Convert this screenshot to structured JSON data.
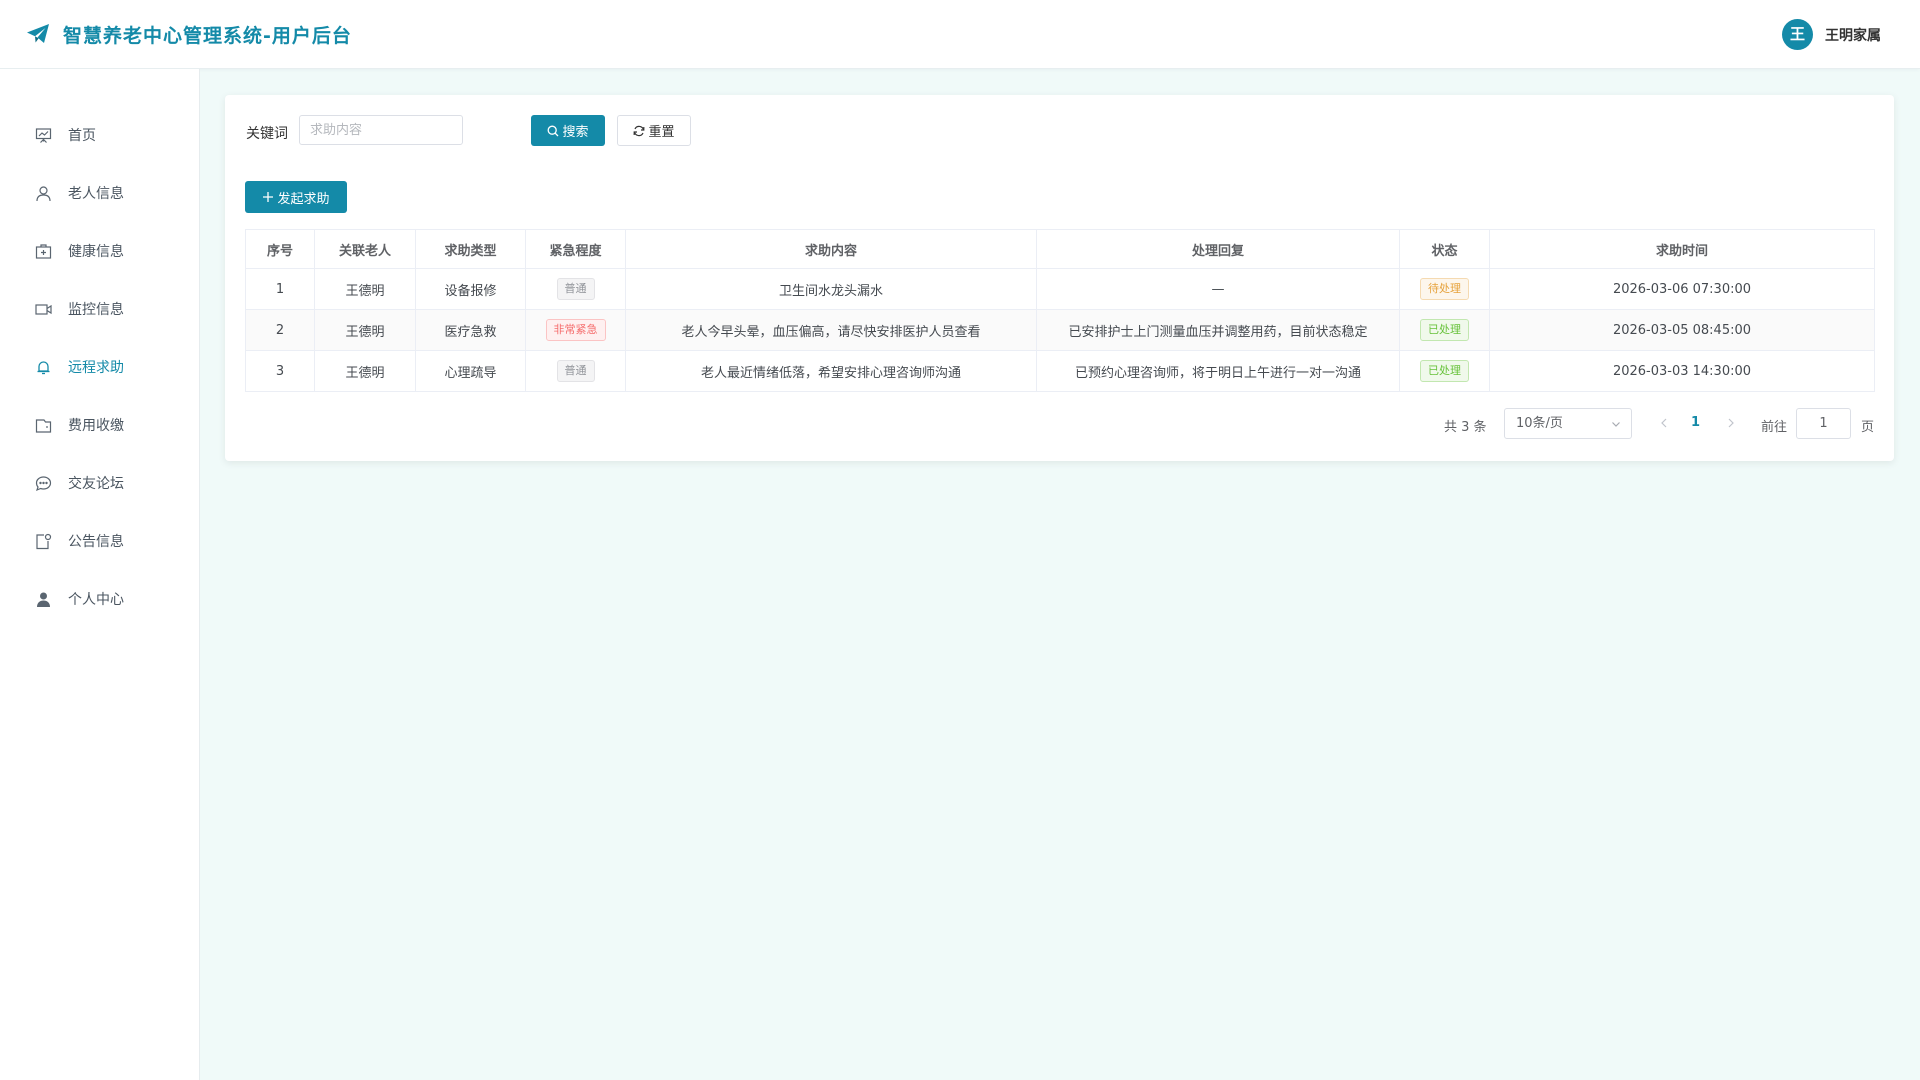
{
  "app": {
    "title": "智慧养老中心管理系统-用户后台",
    "brand_color": "#148aa8"
  },
  "user": {
    "avatar_letter": "王",
    "name": "王明家属"
  },
  "sidebar": {
    "items": [
      {
        "label": "首页",
        "icon": "presentation-icon",
        "active": false
      },
      {
        "label": "老人信息",
        "icon": "user-icon",
        "active": false
      },
      {
        "label": "健康信息",
        "icon": "medical-box-icon",
        "active": false
      },
      {
        "label": "监控信息",
        "icon": "video-camera-icon",
        "active": false
      },
      {
        "label": "远程求助",
        "icon": "bell-icon",
        "active": true
      },
      {
        "label": "费用收缴",
        "icon": "wallet-icon",
        "active": false
      },
      {
        "label": "交友论坛",
        "icon": "chat-icon",
        "active": false
      },
      {
        "label": "公告信息",
        "icon": "notice-icon",
        "active": false
      },
      {
        "label": "个人中心",
        "icon": "person-filled-icon",
        "active": false
      }
    ]
  },
  "search": {
    "label": "关键词",
    "placeholder": "求助内容",
    "search_button": "搜索",
    "reset_button": "重置"
  },
  "actions": {
    "add_button": "发起求助"
  },
  "table": {
    "columns": [
      "序号",
      "关联老人",
      "求助类型",
      "紧急程度",
      "求助内容",
      "处理回复",
      "状态",
      "求助时间"
    ],
    "rows": [
      {
        "index": "1",
        "elder": "王德明",
        "type": "设备报修",
        "urgency": "普通",
        "urgency_level": "normal",
        "content": "卫生间水龙头漏水",
        "reply": "—",
        "status": "待处理",
        "status_level": "pending",
        "time": "2026-03-06 07:30:00"
      },
      {
        "index": "2",
        "elder": "王德明",
        "type": "医疗急救",
        "urgency": "非常紧急",
        "urgency_level": "urgent",
        "content": "老人今早头晕，血压偏高，请尽快安排医护人员查看",
        "reply": "已安排护士上门测量血压并调整用药，目前状态稳定",
        "status": "已处理",
        "status_level": "done",
        "time": "2026-03-05 08:45:00"
      },
      {
        "index": "3",
        "elder": "王德明",
        "type": "心理疏导",
        "urgency": "普通",
        "urgency_level": "normal",
        "content": "老人最近情绪低落，希望安排心理咨询师沟通",
        "reply": "已预约心理咨询师，将于明日上午进行一对一沟通",
        "status": "已处理",
        "status_level": "done",
        "time": "2026-03-03 14:30:00"
      }
    ]
  },
  "pagination": {
    "total_text": "共 3 条",
    "page_size": "10条/页",
    "current_page": "1",
    "goto_label": "前往",
    "goto_value": "1",
    "page_suffix": "页"
  }
}
